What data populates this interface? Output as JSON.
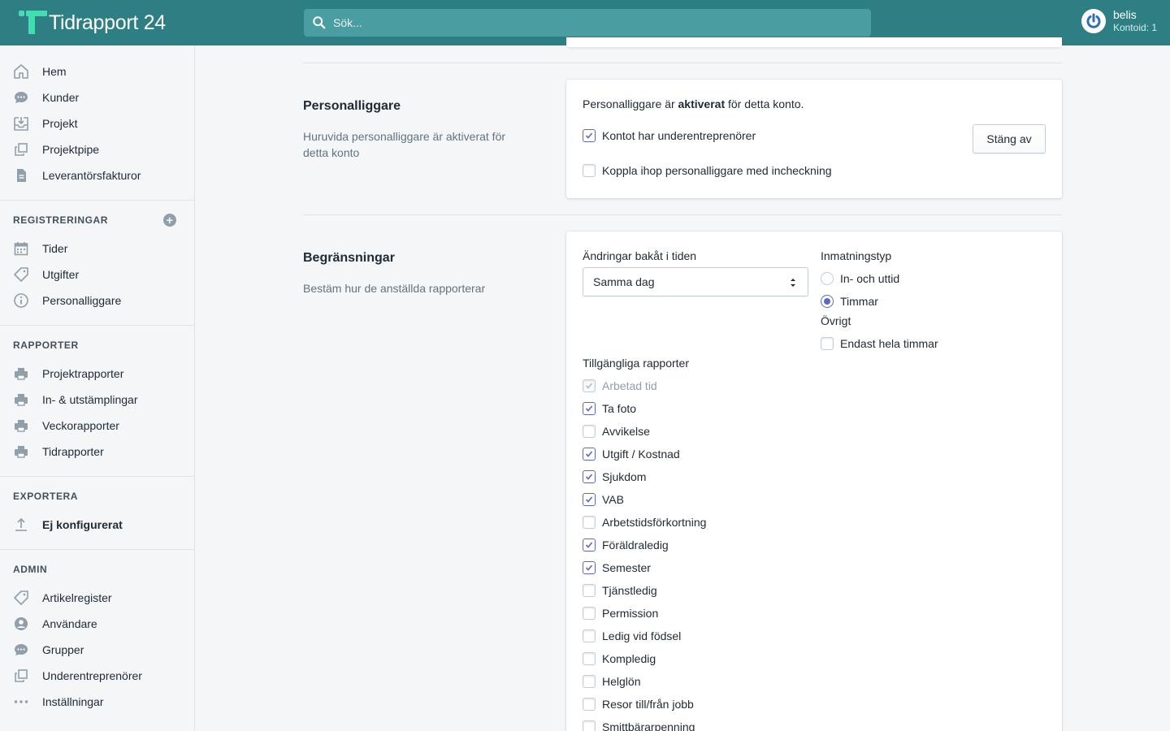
{
  "app": {
    "name": "Tidrapport 24"
  },
  "search": {
    "placeholder": "Sök..."
  },
  "user": {
    "name": "belis",
    "account": "Kontoid: 1"
  },
  "sidebar": {
    "main_items": [
      {
        "label": "Hem",
        "icon": "home-icon"
      },
      {
        "label": "Kunder",
        "icon": "chat-icon"
      },
      {
        "label": "Projekt",
        "icon": "inbox-icon"
      },
      {
        "label": "Projektpipe",
        "icon": "duplicate-icon"
      },
      {
        "label": "Leverantörsfakturor",
        "icon": "document-icon"
      }
    ],
    "registreringar": {
      "title": "REGISTRERINGAR",
      "items": [
        {
          "label": "Tider",
          "icon": "calendar-icon"
        },
        {
          "label": "Utgifter",
          "icon": "tag-icon"
        },
        {
          "label": "Personalliggare",
          "icon": "info-icon"
        }
      ]
    },
    "rapporter": {
      "title": "RAPPORTER",
      "items": [
        {
          "label": "Projektrapporter",
          "icon": "printer-icon"
        },
        {
          "label": "In- & utstämplingar",
          "icon": "printer-icon"
        },
        {
          "label": "Veckorapporter",
          "icon": "printer-icon"
        },
        {
          "label": "Tidrapporter",
          "icon": "printer-icon"
        }
      ]
    },
    "exportera": {
      "title": "EXPORTERA",
      "items": [
        {
          "label": "Ej konfigurerat",
          "icon": "upload-icon"
        }
      ]
    },
    "admin": {
      "title": "ADMIN",
      "items": [
        {
          "label": "Artikelregister",
          "icon": "tag-icon"
        },
        {
          "label": "Användare",
          "icon": "user-icon"
        },
        {
          "label": "Grupper",
          "icon": "chat-icon"
        },
        {
          "label": "Underentreprenörer",
          "icon": "duplicate-icon"
        },
        {
          "label": "Inställningar",
          "icon": "more-icon"
        }
      ]
    }
  },
  "personalliggare": {
    "heading": "Personalliggare",
    "description": "Huruvida personalliggare är aktiverat för detta konto",
    "status_prefix": "Personalliggare är ",
    "status_bold": "aktiverat",
    "status_suffix": " för detta konto.",
    "checkboxes": [
      {
        "label": "Kontot har underentreprenörer",
        "checked": true
      },
      {
        "label": "Koppla ihop personalliggare med incheckning",
        "checked": false
      }
    ],
    "button": "Stäng av"
  },
  "begransningar": {
    "heading": "Begränsningar",
    "description": "Bestäm hur de anställda rapporterar",
    "changes_label": "Ändringar bakåt i tiden",
    "changes_value": "Samma dag",
    "input_type_label": "Inmatningstyp",
    "input_types": [
      {
        "label": "In- och uttid",
        "checked": false
      },
      {
        "label": "Timmar",
        "checked": true
      }
    ],
    "other_label": "Övrigt",
    "other_options": [
      {
        "label": "Endast hela timmar",
        "checked": false
      }
    ],
    "reports_label": "Tillgängliga rapporter",
    "reports": [
      {
        "label": "Arbetad tid",
        "checked": true,
        "disabled": true
      },
      {
        "label": "Ta foto",
        "checked": true
      },
      {
        "label": "Avvikelse",
        "checked": false
      },
      {
        "label": "Utgift / Kostnad",
        "checked": true
      },
      {
        "label": "Sjukdom",
        "checked": true
      },
      {
        "label": "VAB",
        "checked": true
      },
      {
        "label": "Arbetstidsförkortning",
        "checked": false
      },
      {
        "label": "Föräldraledig",
        "checked": true
      },
      {
        "label": "Semester",
        "checked": true
      },
      {
        "label": "Tjänstledig",
        "checked": false
      },
      {
        "label": "Permission",
        "checked": false
      },
      {
        "label": "Ledig vid födsel",
        "checked": false
      },
      {
        "label": "Kompledig",
        "checked": false
      },
      {
        "label": "Helglön",
        "checked": false
      },
      {
        "label": "Resor till/från jobb",
        "checked": false
      },
      {
        "label": "Smittbärarpenning",
        "checked": false
      }
    ]
  },
  "colors": {
    "topbar": "#2e7f83",
    "accent": "#5c6ac4",
    "logo": "#3ee0b0"
  }
}
